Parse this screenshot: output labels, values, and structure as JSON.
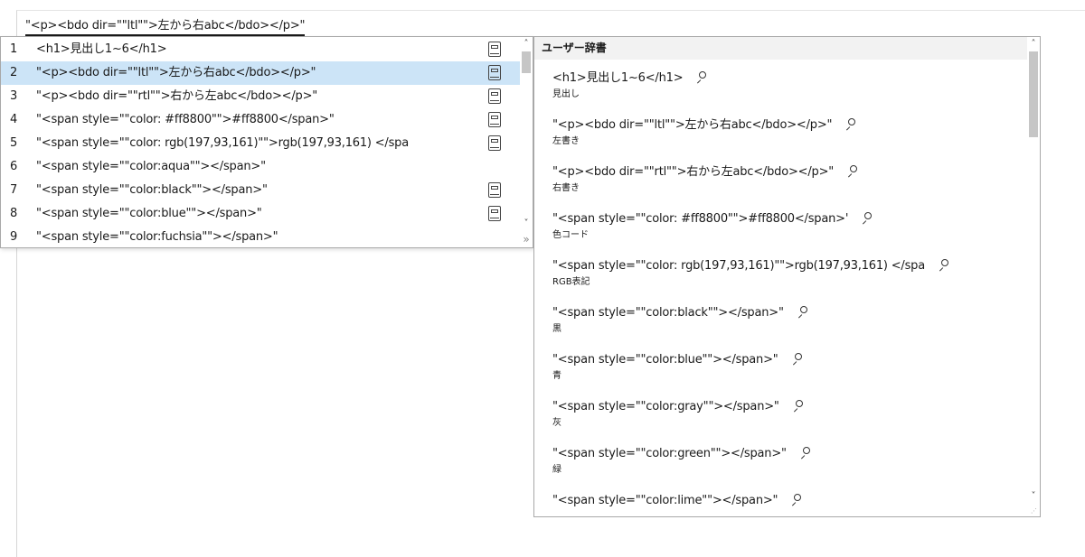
{
  "composition": {
    "text": "\"<p><bdo dir=\"\"ltl\"\">左から右abc</bdo></p>\""
  },
  "candidates": [
    {
      "num": "1",
      "text": "<h1>見出し1~6</h1>",
      "dict": true,
      "selected": false
    },
    {
      "num": "2",
      "text": "\"<p><bdo dir=\"\"ltl\"\">左から右abc</bdo></p>\"",
      "dict": true,
      "selected": true
    },
    {
      "num": "3",
      "text": "\"<p><bdo dir=\"\"rtl\"\">右から左abc</bdo></p>\"",
      "dict": true,
      "selected": false
    },
    {
      "num": "4",
      "text": "\"<span style=\"\"color: #ff8800\"\">#ff8800</span>\"",
      "dict": true,
      "selected": false
    },
    {
      "num": "5",
      "text": "\"<span style=\"\"color: rgb(197,93,161)\"\">rgb(197,93,161) </spa",
      "dict": true,
      "selected": false
    },
    {
      "num": "6",
      "text": "\"<span style=\"\"color:aqua\"\"></span>\"",
      "dict": false,
      "selected": false
    },
    {
      "num": "7",
      "text": "\"<span style=\"\"color:black\"\"></span>\"",
      "dict": true,
      "selected": false
    },
    {
      "num": "8",
      "text": "\"<span style=\"\"color:blue\"\"></span>\"",
      "dict": true,
      "selected": false
    },
    {
      "num": "9",
      "text": "\"<span style=\"\"color:fuchsia\"\"></span>\"",
      "dict": false,
      "selected": false
    }
  ],
  "candidate_scroll": {
    "up": "˄",
    "down": "˅",
    "expand": "»"
  },
  "dictionary": {
    "title": "ユーザー辞書",
    "up": "˄",
    "down": "˅",
    "entries": [
      {
        "word": "<h1>見出し1~6</h1>",
        "reading": "見出し"
      },
      {
        "word": "\"<p><bdo dir=\"\"ltl\"\">左から右abc</bdo></p>\"",
        "reading": "左書き"
      },
      {
        "word": "\"<p><bdo dir=\"\"rtl\"\">右から左abc</bdo></p>\"",
        "reading": "右書き"
      },
      {
        "word": "\"<span style=\"\"color: #ff8800\"\">#ff8800</span>'",
        "reading": "色コード"
      },
      {
        "word": "\"<span style=\"\"color: rgb(197,93,161)\"\">rgb(197,93,161) </spa",
        "reading": "RGB表記"
      },
      {
        "word": "\"<span style=\"\"color:black\"\"></span>\"",
        "reading": "黒"
      },
      {
        "word": "\"<span style=\"\"color:blue\"\"></span>\"",
        "reading": "青"
      },
      {
        "word": "\"<span style=\"\"color:gray\"\"></span>\"",
        "reading": "灰"
      },
      {
        "word": "\"<span style=\"\"color:green\"\"></span>\"",
        "reading": "緑"
      },
      {
        "word": "\"<span style=\"\"color:lime\"\"></span>\"",
        "reading": ""
      }
    ]
  },
  "colors": {
    "selected_row": "#cce4f7",
    "border": "#a8a8a8",
    "header": "#f2f2f2"
  }
}
